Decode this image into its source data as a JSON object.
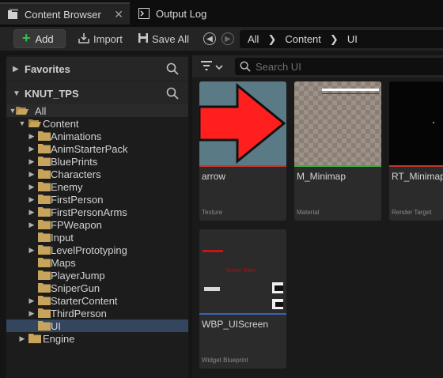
{
  "tabs": [
    {
      "label": "Content Browser",
      "icon": "folder-stack-icon",
      "close": "✕"
    },
    {
      "label": "Output Log",
      "icon": "terminal-icon"
    }
  ],
  "toolbar": {
    "add_label": "Add",
    "import_label": "Import",
    "save_all_label": "Save All"
  },
  "breadcrumb": [
    "All",
    "Content",
    "UI"
  ],
  "favorites": {
    "title": "Favorites"
  },
  "project": {
    "title": "KNUT_TPS"
  },
  "tree": {
    "all": "All",
    "content": "Content",
    "folders": [
      "Animations",
      "AnimStarterPack",
      "BluePrints",
      "Characters",
      "Enemy",
      "FirstPerson",
      "FirstPersonArms",
      "FPWeapon",
      "Input",
      "LevelPrototyping",
      "Maps",
      "PlayerJump",
      "SniperGun",
      "StarterContent",
      "ThirdPerson",
      "UI"
    ],
    "engine": "Engine"
  },
  "search": {
    "placeholder": "Search UI"
  },
  "assets": [
    {
      "name": "arrow",
      "type": "Texture",
      "color": "#c0392b"
    },
    {
      "name": "M_Minimap",
      "type": "Material",
      "color": "#3fae3f"
    },
    {
      "name": "RT_Minimap",
      "type": "Render Target",
      "color": "#c0392b"
    },
    {
      "name": "WBP_UIScreen",
      "type": "Widget Blueprint",
      "color": "#3a63b8",
      "preview_text": "Game Over"
    }
  ],
  "colors": {
    "accent_add": "#36c14a",
    "selected_row": "#34455e",
    "folder": "#c8a35c"
  }
}
